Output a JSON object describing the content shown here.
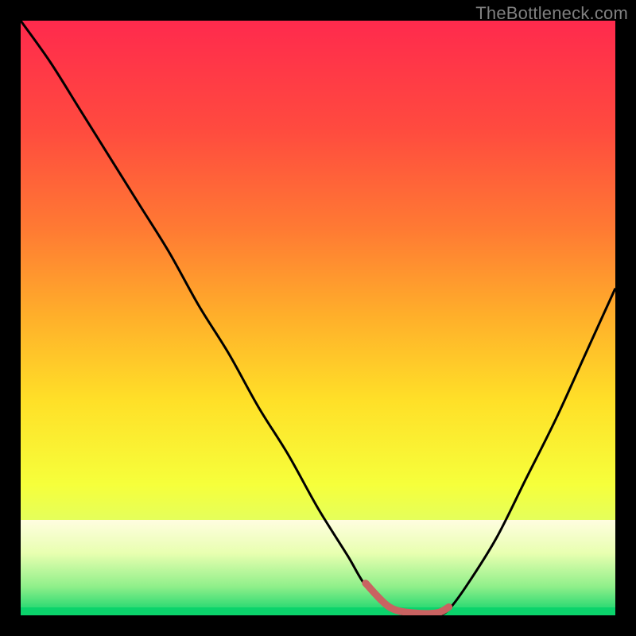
{
  "watermark": "TheBottleneck.com",
  "colors": {
    "frame": "#000000",
    "curve": "#000000",
    "marker": "#c96261",
    "green_band": "#0bd36b",
    "pale_band_top": "#fffde0"
  },
  "gradient_stops": [
    {
      "offset": 0.0,
      "color": "#ff2a4d"
    },
    {
      "offset": 0.18,
      "color": "#ff4a3f"
    },
    {
      "offset": 0.35,
      "color": "#ff7a33"
    },
    {
      "offset": 0.5,
      "color": "#ffb02a"
    },
    {
      "offset": 0.64,
      "color": "#ffe028"
    },
    {
      "offset": 0.78,
      "color": "#f6ff3b"
    },
    {
      "offset": 0.88,
      "color": "#d9ff70"
    },
    {
      "offset": 1.0,
      "color": "#0bd36b"
    }
  ],
  "chart_data": {
    "type": "line",
    "title": "",
    "xlabel": "",
    "ylabel": "",
    "xlim": [
      0,
      100
    ],
    "ylim": [
      0,
      100
    ],
    "x": [
      0,
      5,
      10,
      15,
      20,
      25,
      30,
      35,
      40,
      45,
      50,
      55,
      58,
      62,
      66,
      70,
      72,
      75,
      80,
      85,
      90,
      95,
      100
    ],
    "values": [
      100,
      93,
      85,
      77,
      69,
      61,
      52,
      44,
      35,
      27,
      18,
      10,
      5,
      1,
      0,
      0,
      1,
      5,
      13,
      23,
      33,
      44,
      55
    ],
    "annotations": [],
    "marker_band": {
      "x_start": 58,
      "x_end": 72,
      "y": 0
    }
  }
}
